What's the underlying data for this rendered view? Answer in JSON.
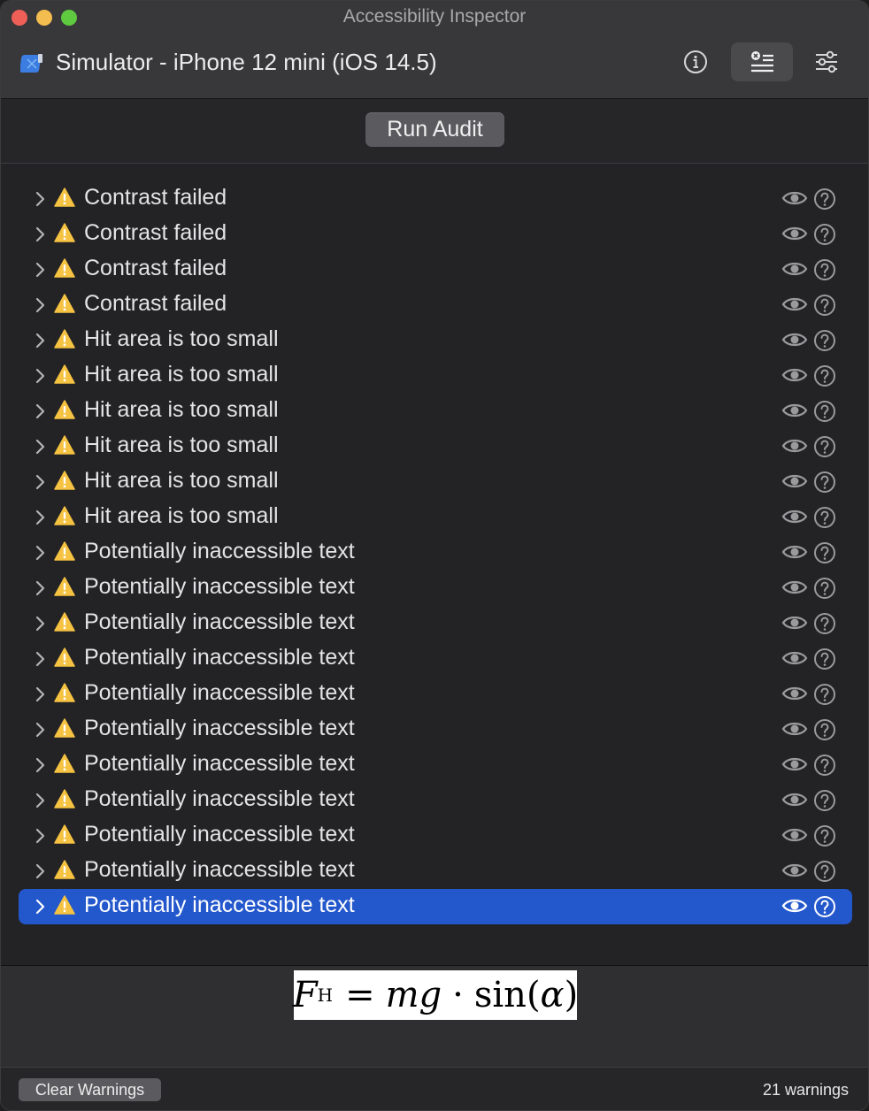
{
  "window": {
    "title": "Accessibility Inspector"
  },
  "toolbar": {
    "target": "Simulator - iPhone 12 mini (iOS 14.5)",
    "info_icon": "info-circle-icon",
    "audit_icon": "audit-list-icon",
    "settings_icon": "sliders-icon"
  },
  "audit": {
    "run_label": "Run Audit"
  },
  "issues": [
    {
      "label": "Contrast failed"
    },
    {
      "label": "Contrast failed"
    },
    {
      "label": "Contrast failed"
    },
    {
      "label": "Contrast failed"
    },
    {
      "label": "Hit area is too small"
    },
    {
      "label": "Hit area is too small"
    },
    {
      "label": "Hit area is too small"
    },
    {
      "label": "Hit area is too small"
    },
    {
      "label": "Hit area is too small"
    },
    {
      "label": "Hit area is too small"
    },
    {
      "label": "Potentially inaccessible text"
    },
    {
      "label": "Potentially inaccessible text"
    },
    {
      "label": "Potentially inaccessible text"
    },
    {
      "label": "Potentially inaccessible text"
    },
    {
      "label": "Potentially inaccessible text"
    },
    {
      "label": "Potentially inaccessible text"
    },
    {
      "label": "Potentially inaccessible text"
    },
    {
      "label": "Potentially inaccessible text"
    },
    {
      "label": "Potentially inaccessible text"
    },
    {
      "label": "Potentially inaccessible text"
    },
    {
      "label": "Potentially inaccessible text",
      "selected": true
    }
  ],
  "detail": {
    "formula": {
      "F": "F",
      "sub": "H",
      "eq": "=",
      "mg": "mg",
      "dot": "·",
      "sin": "sin",
      "open": "(",
      "alpha": "α",
      "close": ")"
    }
  },
  "footer": {
    "clear_label": "Clear Warnings",
    "count": "21 warnings"
  },
  "colors": {
    "selection": "#2357cc",
    "warning": "#f5c242"
  }
}
